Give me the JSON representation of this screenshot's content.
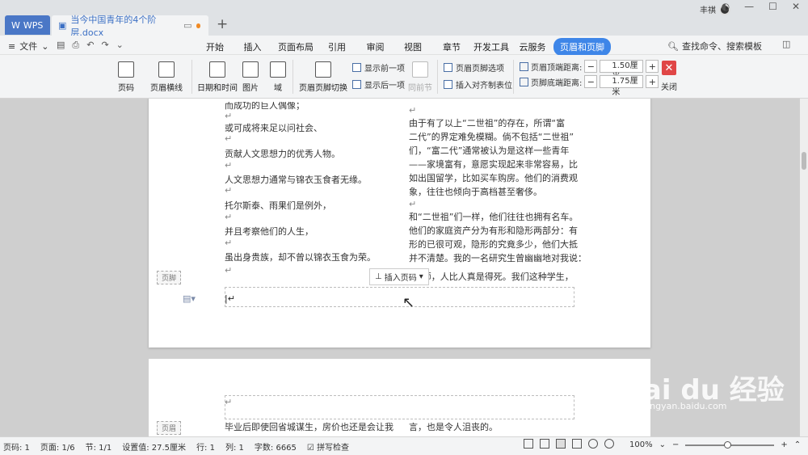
{
  "tabs": {
    "wps": "WPS",
    "doc": "当今中国青年的4个阶层.docx"
  },
  "user": "丰祺",
  "menu": {
    "file": "文件",
    "items": [
      "开始",
      "插入",
      "页面布局",
      "引用",
      "审阅",
      "视图",
      "章节",
      "开发工具",
      "云服务",
      "页眉和页脚"
    ],
    "search": "查找命令、搜索模板"
  },
  "ribbon": {
    "page_num": "页码",
    "header_line": "页眉横线",
    "datetime": "日期和时间",
    "picture": "图片",
    "field": "域",
    "switch": "页眉页脚切换",
    "show_prev": "显示前一项",
    "show_next": "显示后一项",
    "same_prev": "同前节",
    "options": "页眉页脚选项",
    "insert_align_tab": "插入对齐制表位",
    "header_dist_label": "页眉顶端距离:",
    "header_dist": "1.50厘米",
    "footer_dist_label": "页脚底端距离:",
    "footer_dist": "1.75厘米",
    "close": "关闭"
  },
  "left_col": [
    "而成功的巨人偶像；",
    "或可成将来足以问社会、",
    "贡献人文思想力的优秀人物。",
    "人文思想力通常与锦衣玉食者无缘。",
    "托尔斯泰、雨果们是例外，",
    "并且考察他们的人生，",
    "虽出身贵族，却不曾以锦衣玉食为荣。"
  ],
  "right_col": [
    "由于有了以上“二世祖”的存在，所谓“富",
    "二代”的界定难免模糊。倘不包括“二世祖”",
    "们，“富二代”通常被认为是这样一些青年",
    "——家境富有，意愿实现起来非常容易，比",
    "如出国留学，比如买车购房。他们的消费观",
    "象，往往也倾向于高档甚至奢侈。",
    "和“二世祖”们一样，他们往往也拥有名车。",
    "他们的家庭资产分为有形和隐形两部分：有",
    "形的已很可观，隐形的究竟多少，他们大抵",
    "并不清楚。我的一名研究生曾幽幽地对我说：",
    "“老师，人比人真是得死。我们这种学生，"
  ],
  "footer_label": "页脚",
  "header_label": "页眉",
  "insert_page_num": "插入页码",
  "page2": {
    "left": "毕业后即使回省城谋生，房价也还是会让我",
    "right": "言，也是令人沮丧的。"
  },
  "status": {
    "page": "页码: 1",
    "pages": "页面: 1/6",
    "section": "节: 1/1",
    "setting": "设置值: 27.5厘米",
    "row": "行: 1",
    "col": "列: 1",
    "words": "字数: 6665",
    "spell": "拼写检查",
    "zoom": "100%"
  },
  "watermark": {
    "logo": "Bai du 经验",
    "url": "jingyan.baidu.com"
  }
}
